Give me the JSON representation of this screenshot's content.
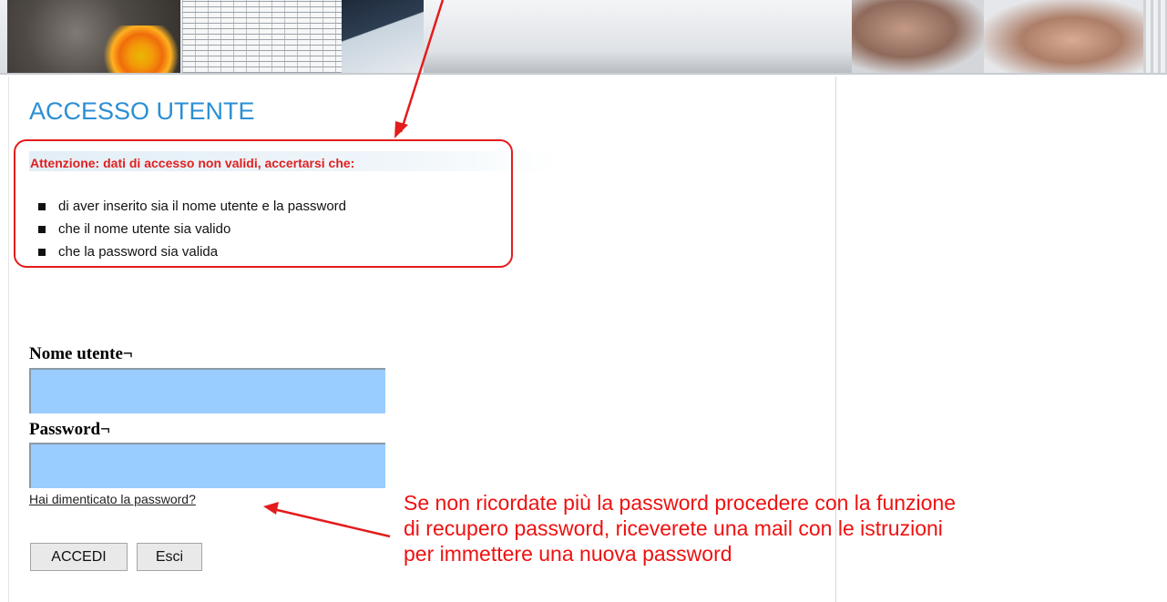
{
  "page": {
    "title": "ACCESSO UTENTE"
  },
  "error": {
    "title": "Attenzione: dati di accesso non validi, accertarsi che:",
    "items": [
      "di aver inserito sia il nome utente e la password",
      "che il nome utente sia valido",
      "che la password sia valida"
    ]
  },
  "form": {
    "username_label": "Nome utente¬",
    "username_value": "",
    "password_label": "Password¬",
    "password_value": "",
    "forgot_link": "Hai dimenticato la password?",
    "submit_label": "ACCEDI",
    "exit_label": "Esci"
  },
  "annotation": {
    "lines": [
      "Se non ricordate più la password procedere con la funzione",
      "di recupero password, riceverete una mail con le istruzioni",
      "per immettere una nuova password"
    ]
  },
  "colors": {
    "title": "#2a8fd4",
    "error": "#e31c1c",
    "input_bg": "#99ccff",
    "annotation": "#ee1111"
  }
}
